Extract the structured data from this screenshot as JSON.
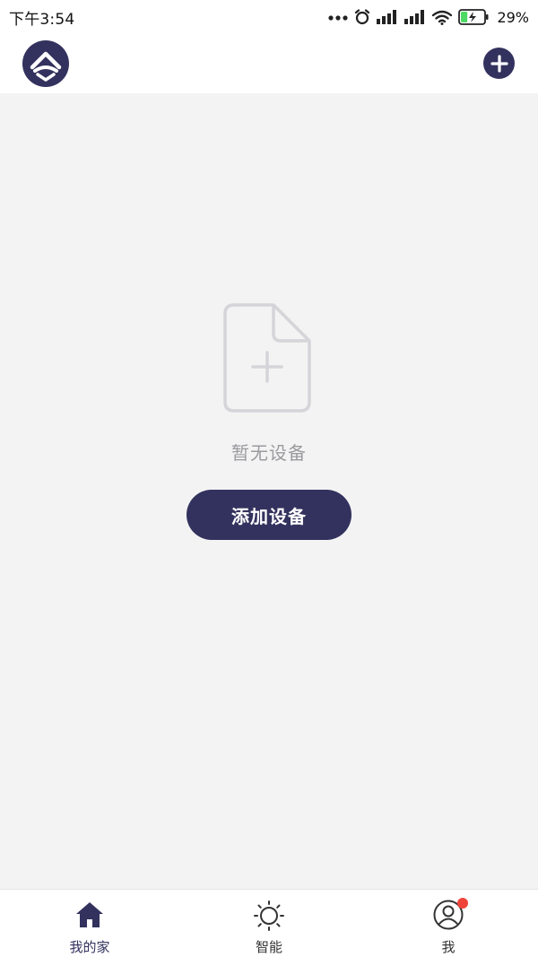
{
  "status_bar": {
    "time": "下午3:54",
    "battery_percent": "29%",
    "battery_level": 0.29,
    "battery_color": "#4cd964"
  },
  "header": {
    "logo_icon": "app-logo-icon",
    "add_icon": "plus-icon"
  },
  "main": {
    "empty_icon": "add-file-icon",
    "empty_text": "暂无设备",
    "add_device_label": "添加设备"
  },
  "tab_bar": {
    "tabs": [
      {
        "label": "我的家",
        "icon": "home-icon",
        "active": true
      },
      {
        "label": "智能",
        "icon": "sun-icon",
        "active": false
      },
      {
        "label": "我",
        "icon": "user-icon",
        "active": false,
        "badge": true
      }
    ]
  },
  "colors": {
    "primary": "#33325e",
    "background": "#f3f3f4",
    "badge": "#f0443a",
    "muted_text": "#9b9b9f"
  }
}
